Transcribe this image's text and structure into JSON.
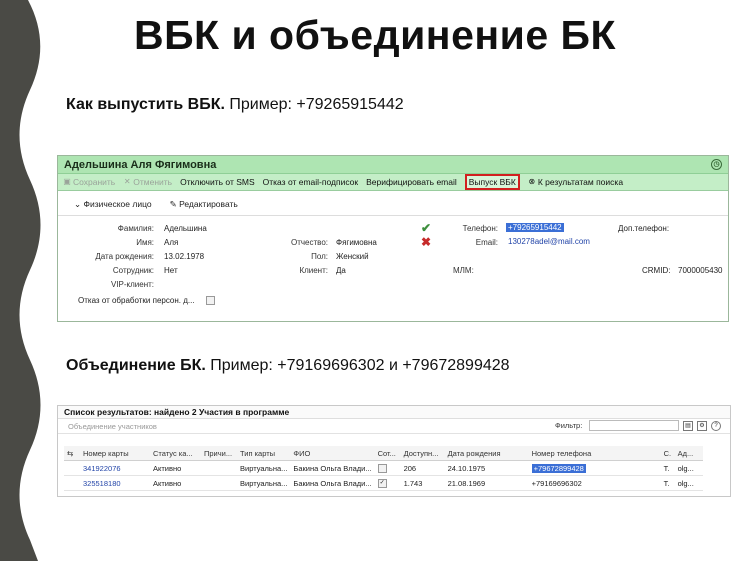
{
  "slide": {
    "title": "ВБК и объединение БК",
    "section1": {
      "bold": "Как выпустить ВБК.",
      "rest": " Пример: +79265915442"
    },
    "section2": {
      "bold": "Объединение БК.",
      "rest": " Пример: +79169696302 и +79672899428"
    }
  },
  "colors": {
    "left_strip": "#4a4a45",
    "card_header": "#aee5b2",
    "toolbar": "#c4eec7",
    "highlight": "#d21f1f",
    "selection": "#3b6fd6"
  },
  "card": {
    "name": "Адельшина Аля Фягимовна",
    "help_icon": "clock-icon",
    "toolbar": {
      "save": "Сохранить",
      "cancel": "Отменить",
      "disable_sms": "Отключить от SMS",
      "email_unsub": "Отказ от email-подписок",
      "verify_email": "Верифицировать email",
      "issue_vbk": "Выпуск ВБК",
      "back_to_results": "К результатам поиска"
    },
    "section_title": "Физическое лицо",
    "edit_label": "Редактировать",
    "fields": {
      "surname_label": "Фамилия:",
      "surname": "Адельшина",
      "name_label": "Имя:",
      "name": "Аля",
      "patronymic_label": "Отчество:",
      "patronymic": "Фягимовна",
      "birth_label": "Дата рождения:",
      "birth": "13.02.1978",
      "sex_label": "Пол:",
      "sex": "Женский",
      "employee_label": "Сотрудник:",
      "employee": "Нет",
      "client_label": "Клиент:",
      "client": "Да",
      "vip_label": "VIP-клиент:",
      "pd_refusal_label": "Отказ от обработки персон. д...",
      "phone_label": "Телефон:",
      "phone": "+79265915442",
      "email_label": "Email:",
      "email": "130278adel@mail.com",
      "extra_phone_label": "Доп.телефон:",
      "mlm_label": "МЛМ:",
      "crmid_label": "CRMID:",
      "crmid": "7000005430"
    }
  },
  "results": {
    "title": "Список результатов: найдено 2 Участия в программе",
    "merge_button": "Объединение участников",
    "filter_label": "Фильтр:",
    "columns": [
      "Номер карты",
      "Статус ка...",
      "Причи...",
      "Тип карты",
      "ФИО",
      "Сот...",
      "Доступн...",
      "Дата рождения",
      "Номер телефона",
      "С.",
      "Ад..."
    ],
    "rows": [
      [
        "341922076",
        "Активно",
        "",
        "Виртуальна...",
        "Бакина Ольга Влади...",
        "",
        "206",
        "24.10.1975",
        "+79672899428",
        "Т.",
        "olg..."
      ],
      [
        "325518180",
        "Активно",
        "",
        "Виртуальна...",
        "Бакина Ольга Влади...",
        "",
        "1.743",
        "21.08.1969",
        "+79169696302",
        "Т.",
        "olg..."
      ]
    ],
    "row_checked": [
      false,
      true
    ]
  }
}
